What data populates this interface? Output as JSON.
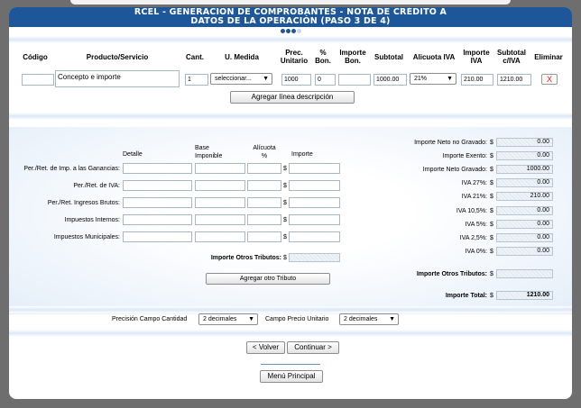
{
  "header": {
    "line1": "RCEL - GENERACIÓN DE COMPROBANTES - NOTA DE CRÉDITO A",
    "line2": "DATOS DE LA OPERACIÓN (PASO 3 DE 4)"
  },
  "columns": {
    "codigo": "Código",
    "producto": "Producto/Servicio",
    "cant": "Cant.",
    "umedida": "U. Medida",
    "prec1": "Prec.",
    "prec2": "Unitario",
    "bon1": "%",
    "bon2": "Bon.",
    "impbon1": "Importe",
    "impbon2": "Bon.",
    "subtotal": "Subtotal",
    "alicuota": "Alicuota IVA",
    "impiva1": "Importe",
    "impiva2": "IVA",
    "subiva1": "Subtotal",
    "subiva2": "c/IVA",
    "eliminar": "Eliminar"
  },
  "line": {
    "codigo": "",
    "producto": "Concepto e importe",
    "cant": "1",
    "umedida": "seleccionar...",
    "precio": "1000",
    "bon": "0",
    "impbon": "",
    "subtotal": "1000.00",
    "alicuota": "21%",
    "impiva": "210.00",
    "subiva": "1210.00",
    "delete": "X"
  },
  "add_line_button": "Agregar línea descripción",
  "tributos": {
    "headers": {
      "detalle": "Detalle",
      "base1": "Base",
      "base2": "Imponible",
      "alic1": "Alícuota",
      "alic2": "%",
      "importe": "Importe"
    },
    "rows": [
      "Per./Ret. de Imp. a las Ganancias:",
      "Per./Ret. de IVA:",
      "Per./Ret. Ingresos Brutos:",
      "Impuestos Internos:",
      "Impuestos Municipales:"
    ],
    "currency": "$",
    "otros_label": "Importe Otros Tributos:",
    "add_button": "Agregar otro Tributo"
  },
  "totals": {
    "currency": "$",
    "rows": [
      {
        "label": "Importe Neto no Gravado:",
        "value": "0.00"
      },
      {
        "label": "Importe Exento:",
        "value": "0.00"
      },
      {
        "label": "Importe Neto Gravado:",
        "value": "1000.00"
      },
      {
        "label": "IVA 27%:",
        "value": "0.00"
      },
      {
        "label": "IVA 21%:",
        "value": "210.00"
      },
      {
        "label": "IVA 10,5%:",
        "value": "0.00"
      },
      {
        "label": "IVA 5%:",
        "value": "0.00"
      },
      {
        "label": "IVA 2,5%:",
        "value": "0.00"
      },
      {
        "label": "IVA 0%:",
        "value": "0.00"
      }
    ],
    "otros_label": "Importe Otros Tributos:",
    "otros_value": "",
    "total_label": "Importe Total:",
    "total_value": "1210.00"
  },
  "precision": {
    "cantidad_label": "Precisión Campo Cantidad",
    "cantidad_value": "2 decimales",
    "precio_label": "Campo Precio Unitario",
    "precio_value": "2 decimales"
  },
  "nav": {
    "back": "< Volver",
    "next": "Continuar >",
    "menu": "Menú Principal"
  }
}
